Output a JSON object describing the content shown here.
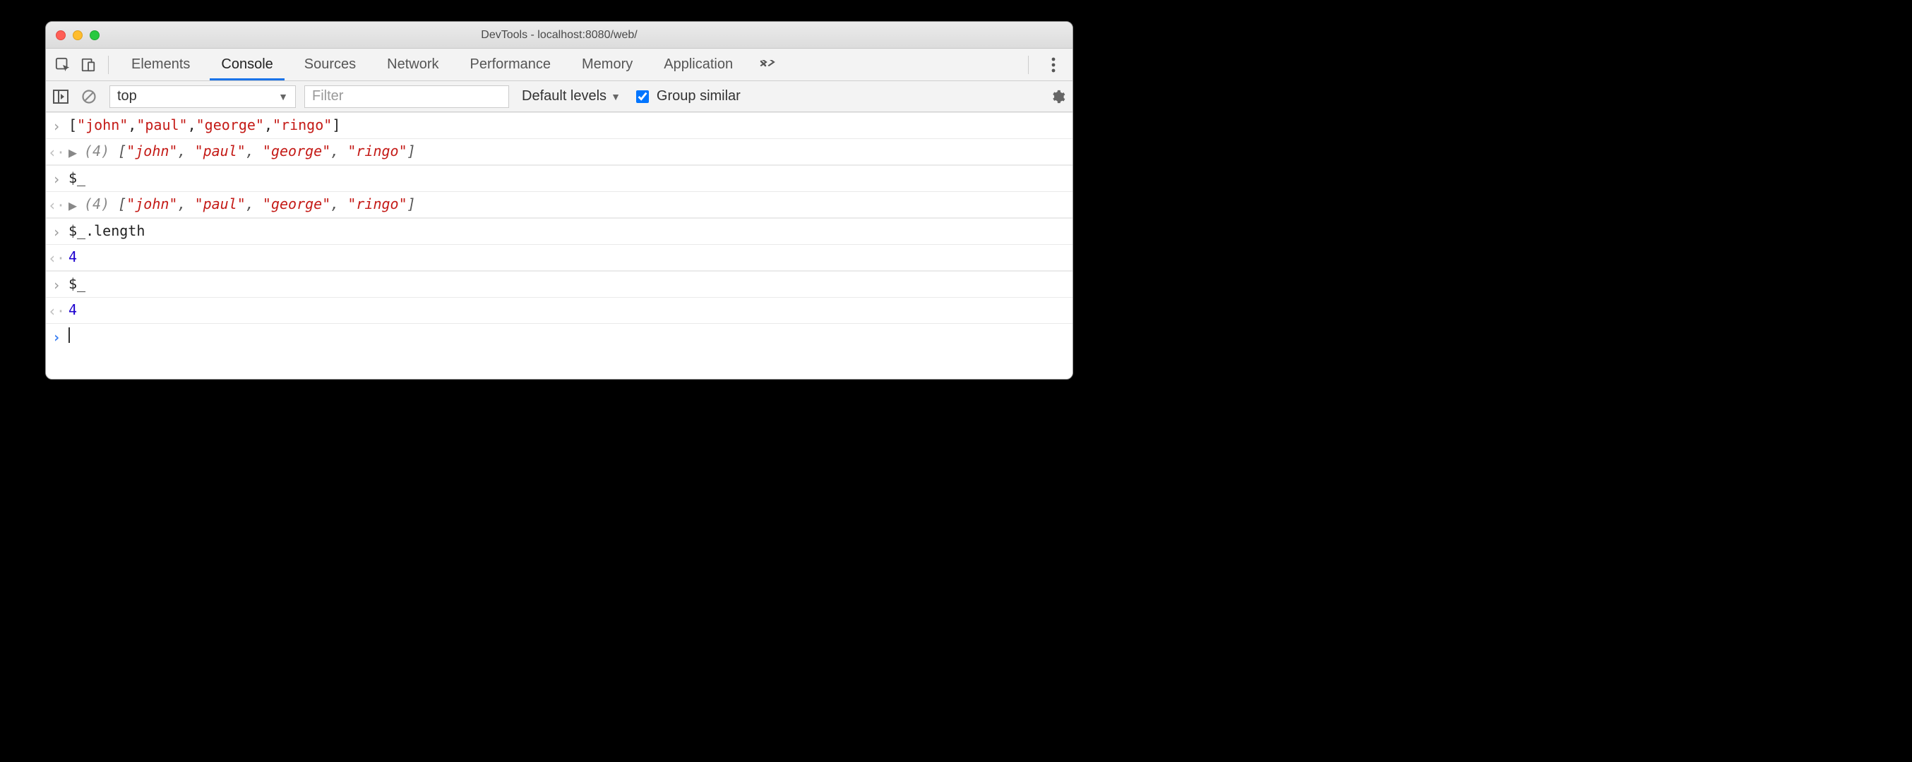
{
  "window": {
    "title": "DevTools - localhost:8080/web/"
  },
  "tabs": {
    "items": [
      "Elements",
      "Console",
      "Sources",
      "Network",
      "Performance",
      "Memory",
      "Application"
    ],
    "active_index": 1
  },
  "console_toolbar": {
    "context": "top",
    "filter_placeholder": "Filter",
    "levels_label": "Default levels",
    "group_similar_label": "Group similar",
    "group_similar_checked": true
  },
  "log": {
    "entries": [
      {
        "kind": "input",
        "raw": "[\"john\",\"paul\",\"george\",\"ringo\"]",
        "tokens": [
          {
            "t": "[",
            "cls": "punc"
          },
          {
            "t": "\"john\"",
            "cls": "str"
          },
          {
            "t": ",",
            "cls": "punc"
          },
          {
            "t": "\"paul\"",
            "cls": "str"
          },
          {
            "t": ",",
            "cls": "punc"
          },
          {
            "t": "\"george\"",
            "cls": "str"
          },
          {
            "t": ",",
            "cls": "punc"
          },
          {
            "t": "\"ringo\"",
            "cls": "str"
          },
          {
            "t": "]",
            "cls": "punc"
          }
        ]
      },
      {
        "kind": "result-array",
        "length": 4,
        "items": [
          "\"john\"",
          "\"paul\"",
          "\"george\"",
          "\"ringo\""
        ]
      },
      {
        "kind": "input",
        "raw": "$_",
        "tokens": [
          {
            "t": "$_",
            "cls": "punc"
          }
        ]
      },
      {
        "kind": "result-array",
        "length": 4,
        "items": [
          "\"john\"",
          "\"paul\"",
          "\"george\"",
          "\"ringo\""
        ]
      },
      {
        "kind": "input",
        "raw": "$_.length",
        "tokens": [
          {
            "t": "$_.length",
            "cls": "punc"
          }
        ]
      },
      {
        "kind": "result-number",
        "value": "4"
      },
      {
        "kind": "input",
        "raw": "$_",
        "tokens": [
          {
            "t": "$_",
            "cls": "punc"
          }
        ]
      },
      {
        "kind": "result-number",
        "value": "4"
      },
      {
        "kind": "live-prompt"
      }
    ]
  }
}
